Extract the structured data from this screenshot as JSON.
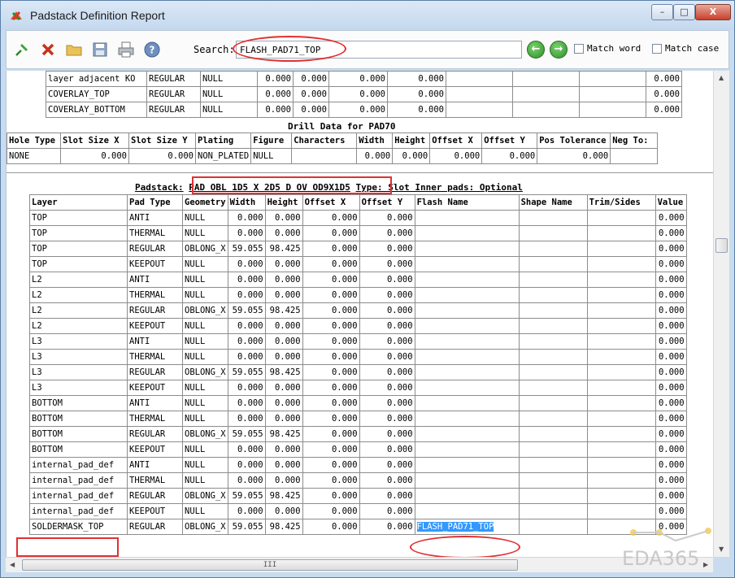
{
  "window": {
    "title": "Padstack Definition Report",
    "min_label": "–",
    "max_label": "□",
    "close_label": "X"
  },
  "toolbar": {
    "icons": [
      "pin-icon",
      "delete-icon",
      "open-folder-icon",
      "save-icon",
      "print-icon",
      "help-icon"
    ],
    "search_label": "Search:",
    "search_value": "FLASH_PAD71_TOP",
    "back_label": "←",
    "forward_label": "→",
    "match_word_label": "Match word",
    "match_case_label": "Match case"
  },
  "top_rows": [
    [
      "layer adjacent KO",
      "REGULAR",
      "NULL",
      "0.000",
      "0.000",
      "0.000",
      "0.000",
      "",
      "",
      "",
      "0.000"
    ],
    [
      "COVERLAY_TOP",
      "REGULAR",
      "NULL",
      "0.000",
      "0.000",
      "0.000",
      "0.000",
      "",
      "",
      "",
      "0.000"
    ],
    [
      "COVERLAY_BOTTOM",
      "REGULAR",
      "NULL",
      "0.000",
      "0.000",
      "0.000",
      "0.000",
      "",
      "",
      "",
      "0.000"
    ]
  ],
  "drill": {
    "title": "Drill Data for PAD70",
    "headers": [
      "Hole Type",
      "Slot Size X",
      "Slot Size Y",
      "Plating",
      "Figure",
      "Characters",
      "Width",
      "Height",
      "Offset X",
      "Offset Y",
      "Pos Tolerance",
      "Neg To:"
    ],
    "row": [
      "NONE",
      "0.000",
      "0.000",
      "NON_PLATED",
      "NULL",
      "",
      "0.000",
      "0.000",
      "0.000",
      "0.000",
      "0.000",
      ""
    ]
  },
  "padstack": {
    "label": "Padstack:",
    "name": "PAD OBL 1D5 X 2D5 D OV OD9X1D5",
    "type_text": "Type: Slot Inner pads: Optional",
    "headers": [
      "Layer",
      "Pad Type",
      "Geometry",
      "Width",
      "Height",
      "Offset X",
      "Offset Y",
      "Flash Name",
      "Shape Name",
      "Trim/Sides",
      "Value"
    ],
    "rows": [
      [
        "TOP",
        "ANTI",
        "NULL",
        "0.000",
        "0.000",
        "0.000",
        "0.000",
        "",
        "",
        "",
        "0.000"
      ],
      [
        "TOP",
        "THERMAL",
        "NULL",
        "0.000",
        "0.000",
        "0.000",
        "0.000",
        "",
        "",
        "",
        "0.000"
      ],
      [
        "TOP",
        "REGULAR",
        "OBLONG_X",
        "59.055",
        "98.425",
        "0.000",
        "0.000",
        "",
        "",
        "",
        "0.000"
      ],
      [
        "TOP",
        "KEEPOUT",
        "NULL",
        "0.000",
        "0.000",
        "0.000",
        "0.000",
        "",
        "",
        "",
        "0.000"
      ],
      [
        "L2",
        "ANTI",
        "NULL",
        "0.000",
        "0.000",
        "0.000",
        "0.000",
        "",
        "",
        "",
        "0.000"
      ],
      [
        "L2",
        "THERMAL",
        "NULL",
        "0.000",
        "0.000",
        "0.000",
        "0.000",
        "",
        "",
        "",
        "0.000"
      ],
      [
        "L2",
        "REGULAR",
        "OBLONG_X",
        "59.055",
        "98.425",
        "0.000",
        "0.000",
        "",
        "",
        "",
        "0.000"
      ],
      [
        "L2",
        "KEEPOUT",
        "NULL",
        "0.000",
        "0.000",
        "0.000",
        "0.000",
        "",
        "",
        "",
        "0.000"
      ],
      [
        "L3",
        "ANTI",
        "NULL",
        "0.000",
        "0.000",
        "0.000",
        "0.000",
        "",
        "",
        "",
        "0.000"
      ],
      [
        "L3",
        "THERMAL",
        "NULL",
        "0.000",
        "0.000",
        "0.000",
        "0.000",
        "",
        "",
        "",
        "0.000"
      ],
      [
        "L3",
        "REGULAR",
        "OBLONG_X",
        "59.055",
        "98.425",
        "0.000",
        "0.000",
        "",
        "",
        "",
        "0.000"
      ],
      [
        "L3",
        "KEEPOUT",
        "NULL",
        "0.000",
        "0.000",
        "0.000",
        "0.000",
        "",
        "",
        "",
        "0.000"
      ],
      [
        "BOTTOM",
        "ANTI",
        "NULL",
        "0.000",
        "0.000",
        "0.000",
        "0.000",
        "",
        "",
        "",
        "0.000"
      ],
      [
        "BOTTOM",
        "THERMAL",
        "NULL",
        "0.000",
        "0.000",
        "0.000",
        "0.000",
        "",
        "",
        "",
        "0.000"
      ],
      [
        "BOTTOM",
        "REGULAR",
        "OBLONG_X",
        "59.055",
        "98.425",
        "0.000",
        "0.000",
        "",
        "",
        "",
        "0.000"
      ],
      [
        "BOTTOM",
        "KEEPOUT",
        "NULL",
        "0.000",
        "0.000",
        "0.000",
        "0.000",
        "",
        "",
        "",
        "0.000"
      ],
      [
        "internal_pad_def",
        "ANTI",
        "NULL",
        "0.000",
        "0.000",
        "0.000",
        "0.000",
        "",
        "",
        "",
        "0.000"
      ],
      [
        "internal_pad_def",
        "THERMAL",
        "NULL",
        "0.000",
        "0.000",
        "0.000",
        "0.000",
        "",
        "",
        "",
        "0.000"
      ],
      [
        "internal_pad_def",
        "REGULAR",
        "OBLONG_X",
        "59.055",
        "98.425",
        "0.000",
        "0.000",
        "",
        "",
        "",
        "0.000"
      ],
      [
        "internal_pad_def",
        "KEEPOUT",
        "NULL",
        "0.000",
        "0.000",
        "0.000",
        "0.000",
        "",
        "",
        "",
        "0.000"
      ],
      [
        "SOLDERMASK_TOP",
        "REGULAR",
        "OBLONG_X",
        "59.055",
        "98.425",
        "0.000",
        "0.000",
        "FLASH_PAD71_TOP",
        "",
        "",
        "0.000"
      ]
    ]
  },
  "scroll": {
    "grip": "III"
  },
  "watermark": "EDA365"
}
